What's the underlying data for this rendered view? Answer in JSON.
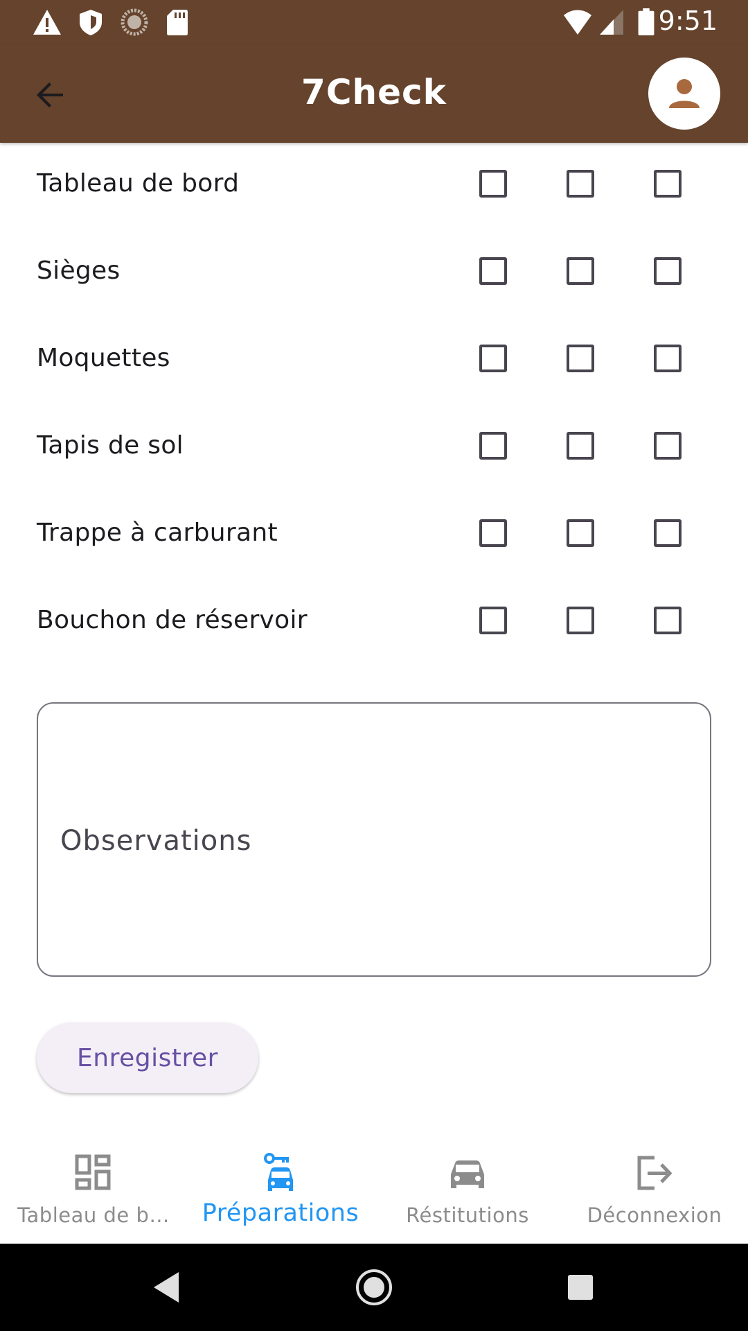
{
  "status_bar": {
    "time": "9:51",
    "icons_left": [
      "warning-icon",
      "shield-icon",
      "sync-icon",
      "sd-card-icon"
    ],
    "icons_right": [
      "wifi-icon",
      "signal-icon",
      "battery-icon"
    ]
  },
  "app_bar": {
    "title": "7Check",
    "back_icon": "arrow-back-icon",
    "account_icon": "account-icon",
    "color": "#65432c"
  },
  "checklist": {
    "rows": [
      {
        "label": "Tableau de bord"
      },
      {
        "label": "Sièges"
      },
      {
        "label": "Moquettes"
      },
      {
        "label": "Tapis de sol"
      },
      {
        "label": "Trappe à carburant"
      },
      {
        "label": "Bouchon de réservoir"
      }
    ]
  },
  "observations": {
    "label": "Observations",
    "value": ""
  },
  "actions": {
    "save_label": "Enregistrer"
  },
  "bottom_nav": {
    "items": [
      {
        "label": "Tableau de b…",
        "icon": "dashboard-icon",
        "active": false
      },
      {
        "label": "Préparations",
        "icon": "car-key-icon",
        "active": true
      },
      {
        "label": "Réstitutions",
        "icon": "car-icon",
        "active": false
      },
      {
        "label": "Déconnexion",
        "icon": "logout-icon",
        "active": false
      }
    ],
    "active_color": "#2196f3",
    "inactive_color": "#8c8c8c"
  },
  "system_nav": {
    "icons": [
      "back-triangle-icon",
      "home-circle-icon",
      "recents-square-icon"
    ]
  }
}
